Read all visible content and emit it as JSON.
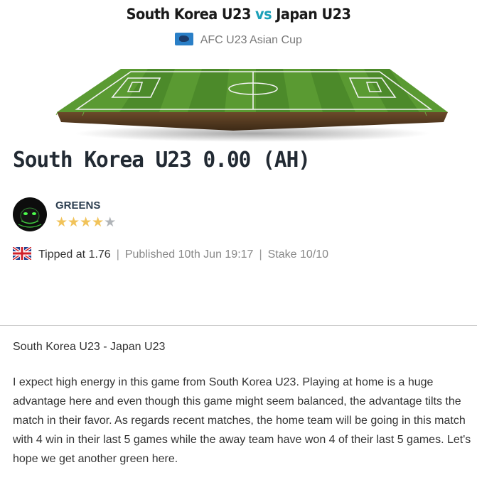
{
  "match": {
    "home": "South Korea U23",
    "vs": "vs",
    "away": "Japan U23"
  },
  "competition": {
    "name": "AFC U23 Asian Cup",
    "icon": "asia-flag-icon"
  },
  "tip": {
    "title": "South Korea U23 0.00 (AH)"
  },
  "tipster": {
    "name": "GREENS",
    "rating": 4,
    "max_rating": 5,
    "rating_star_color": "#f1c35a"
  },
  "meta": {
    "flag_icon": "uk-flag-icon",
    "odds": "Tipped at 1.76",
    "published": "Published 10th Jun 19:17",
    "stake": "Stake 10/10"
  },
  "article": {
    "match_line": "South Korea U23 - Japan U23",
    "body": "I expect high energy in this game from South Korea U23. Playing at home is a huge advantage here and even though this game might seem balanced, the advantage tilts the match in their favor. As regards recent matches, the home team will be going in this match with 4 win in their last 5 games while the away team have won 4 of their last 5 games. Let's hope we get another green here."
  },
  "colors": {
    "vs_accent": "#1aa0b8",
    "grass": "#5a9a32"
  }
}
